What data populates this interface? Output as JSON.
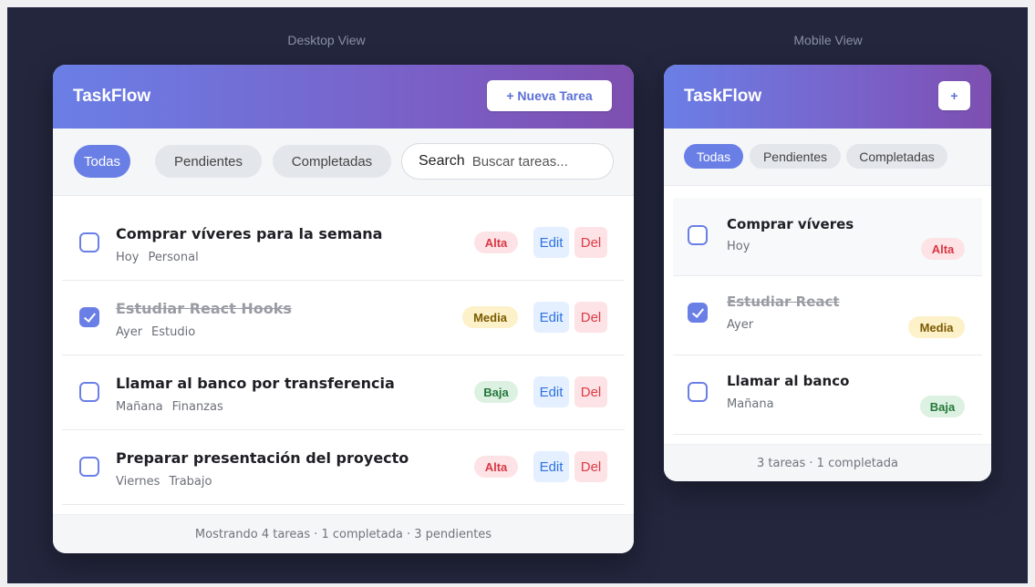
{
  "labels": {
    "desktop": "Desktop View",
    "mobile": "Mobile View"
  },
  "desktop": {
    "brand": "TaskFlow",
    "new_button": "+ Nueva Tarea",
    "filters": [
      "Todas",
      "Pendientes",
      "Completadas"
    ],
    "active_filter": "Todas",
    "search_label": "Search",
    "search_placeholder": "Buscar tareas...",
    "tasks": [
      {
        "title": "Comprar víveres para la semana",
        "date": "Hoy",
        "category": "Personal",
        "priority": "Alta",
        "completed": false
      },
      {
        "title": "Estudiar React Hooks",
        "date": "Ayer",
        "category": "Estudio",
        "priority": "Media",
        "completed": true
      },
      {
        "title": "Llamar al banco por transferencia",
        "date": "Mañana",
        "category": "Finanzas",
        "priority": "Baja",
        "completed": false
      },
      {
        "title": "Preparar presentación del proyecto",
        "date": "Viernes",
        "category": "Trabajo",
        "priority": "Alta",
        "completed": false
      }
    ],
    "edit_label": "Edit",
    "delete_label": "Del",
    "footer": "Mostrando 4 tareas · 1 completada · 3 pendientes"
  },
  "mobile": {
    "brand": "TaskFlow",
    "new_button": "+",
    "filters": [
      "Todas",
      "Pendientes",
      "Completadas"
    ],
    "active_filter": "Todas",
    "tasks": [
      {
        "title": "Comprar víveres",
        "date": "Hoy",
        "priority": "Alta",
        "completed": false
      },
      {
        "title": "Estudiar React",
        "date": "Ayer",
        "priority": "Media",
        "completed": true
      },
      {
        "title": "Llamar al banco",
        "date": "Mañana",
        "priority": "Baja",
        "completed": false
      }
    ],
    "footer": "3 tareas · 1 completada"
  },
  "colors": {
    "accent": "#6a7fe6",
    "header_gradient_end": "#7d4fb0",
    "background": "#23263d",
    "priority_alta": "#d73845",
    "priority_media": "#7a5a00",
    "priority_baja": "#24773b"
  }
}
